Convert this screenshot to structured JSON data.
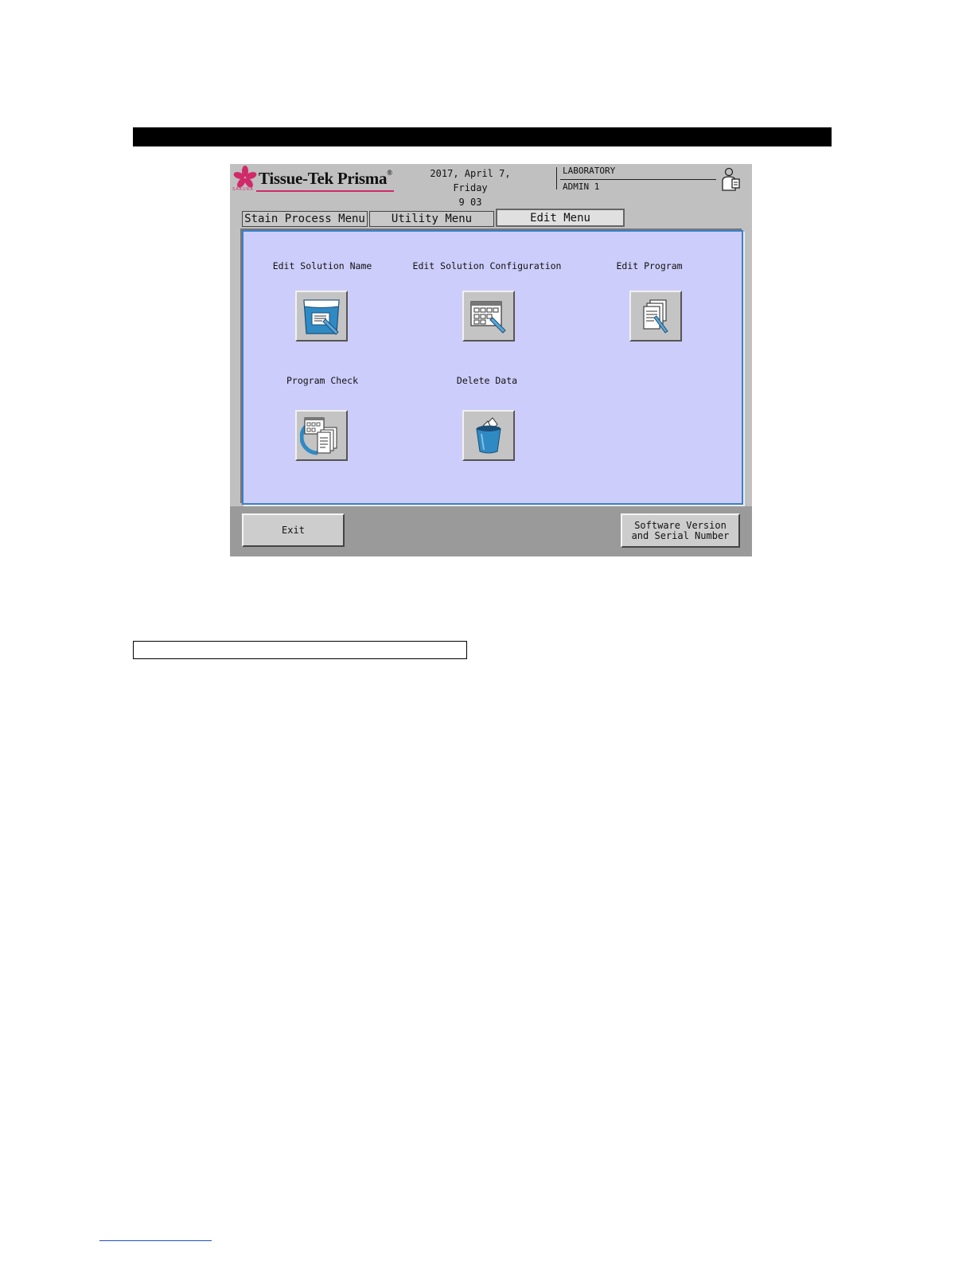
{
  "app": {
    "brand": "Tissue-Tek Prisma",
    "brand_mark": "®",
    "brand_subtext": "SAKURA"
  },
  "header": {
    "date": "2017, April 7, Friday",
    "time": "9 03",
    "department": "LABORATORY",
    "user": "ADMIN 1"
  },
  "tabs": [
    {
      "label": "Stain Process Menu",
      "active": false
    },
    {
      "label": "Utility Menu",
      "active": false
    },
    {
      "label": "Edit Menu",
      "active": true
    }
  ],
  "menu_items": [
    {
      "label": "Edit Solution Name",
      "icon": "solution-name-icon"
    },
    {
      "label": "Edit Solution Configuration",
      "icon": "solution-configuration-icon"
    },
    {
      "label": "Edit Program",
      "icon": "program-documents-icon"
    },
    {
      "label": "Program Check",
      "icon": "program-check-icon"
    },
    {
      "label": "Delete Data",
      "icon": "trash-icon"
    }
  ],
  "footer": {
    "exit_label": "Exit",
    "software_line1": "Software Version",
    "software_line2": "and Serial Number"
  },
  "colors": {
    "panel_bg": "#cdcdfb",
    "panel_border": "#3a7fc8",
    "brand_pink": "#d02a6a",
    "icon_blue": "#2f8ac4"
  }
}
